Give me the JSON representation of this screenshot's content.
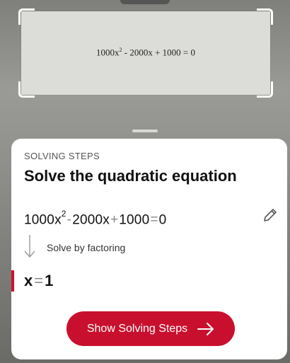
{
  "camera": {
    "captured_equation": {
      "coef_a": "1000x",
      "exp": "2",
      "rest": " - 2000x + 1000 = 0"
    }
  },
  "sheet": {
    "section_label": "SOLVING STEPS",
    "title": "Solve the quadratic equation",
    "equation": {
      "a": "1000",
      "var": "x",
      "exp": "2",
      "op1": "-",
      "b": "2000",
      "var2": "x",
      "op2": "+",
      "c": "1000",
      "eq": "=",
      "rhs": "0"
    },
    "method": "Solve by factoring",
    "answer": {
      "var": "x",
      "eq": "=",
      "val": "1"
    },
    "cta_label": "Show Solving Steps"
  },
  "icons": {
    "edit": "pencil-icon",
    "step": "down-arrow-icon",
    "cta": "arrow-right-icon"
  },
  "colors": {
    "accent": "#c8102e"
  }
}
